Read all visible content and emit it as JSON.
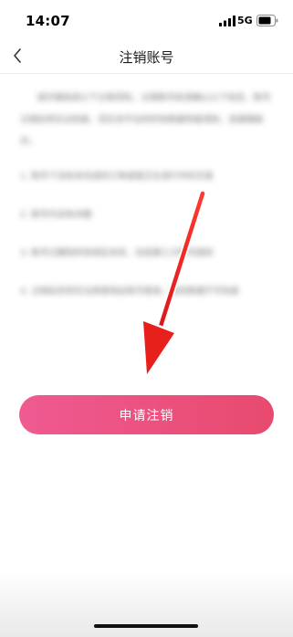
{
  "status_bar": {
    "time": "14:07",
    "network": "5G",
    "icons": [
      "signal-icon",
      "battery-icon"
    ]
  },
  "nav": {
    "back_icon": "chevron-left-icon",
    "title": "注销账号"
  },
  "notice": {
    "paragraph": "请仔细阅读以下注销须知，注销账号前请确认以下信息，账号注销后将无法恢复，您在本平台的所有数据将被清除，请谨慎操作。",
    "items": [
      "1. 账号下没有未完成的订单或者正在进行中的交易",
      "2. 账号内没有余额",
      "3. 账号已解除所有绑定关系，包括第三方账号授权",
      "4. 注销后您将无法再使用此账号登录，相关数据不可恢复"
    ]
  },
  "apply_button": {
    "label": "申请注销"
  },
  "colors": {
    "button_start": "#ef5a92",
    "button_end": "#e84a6e",
    "arrow": "#e8201c"
  }
}
